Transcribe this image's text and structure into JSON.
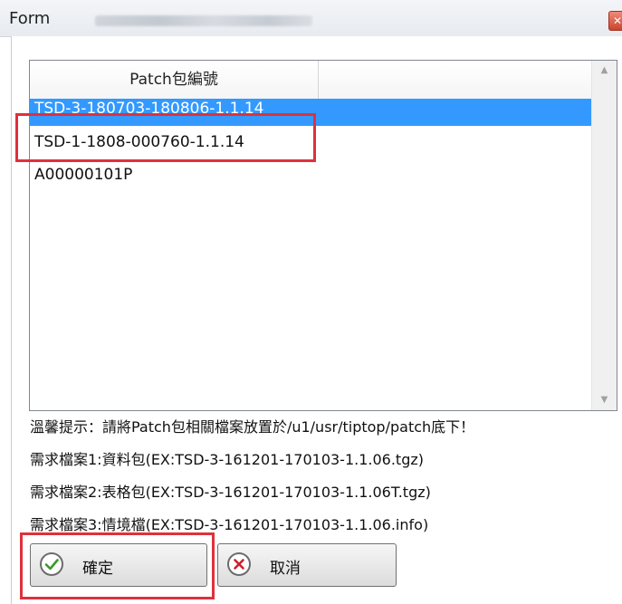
{
  "window": {
    "title": "Form"
  },
  "list": {
    "column_header": "Patch包編號",
    "rows": [
      {
        "label": "TSD-3-180703-180806-1.1.14"
      },
      {
        "label": "TSD-1-1808-000760-1.1.14"
      },
      {
        "label": "A00000101P"
      }
    ]
  },
  "hints": {
    "line1": "溫馨提示：請將Patch包相關檔案放置於/u1/usr/tiptop/patch底下！",
    "line2": "需求檔案1:資料包(EX:TSD-3-161201-170103-1.1.06.tgz)",
    "line3": "需求檔案2:表格包(EX:TSD-3-161201-170103-1.1.06T.tgz)",
    "line4": "需求檔案3:情境檔(EX:TSD-3-161201-170103-1.1.06.info)"
  },
  "buttons": {
    "ok_label": "確定",
    "cancel_label": "取消"
  },
  "icons": {
    "ok": "check-circle-icon",
    "cancel": "x-circle-icon"
  },
  "colors": {
    "selection": "#3399ff",
    "highlight": "#e0303c",
    "ok_icon": "#3a9a2a",
    "cancel_icon": "#d0202a"
  }
}
